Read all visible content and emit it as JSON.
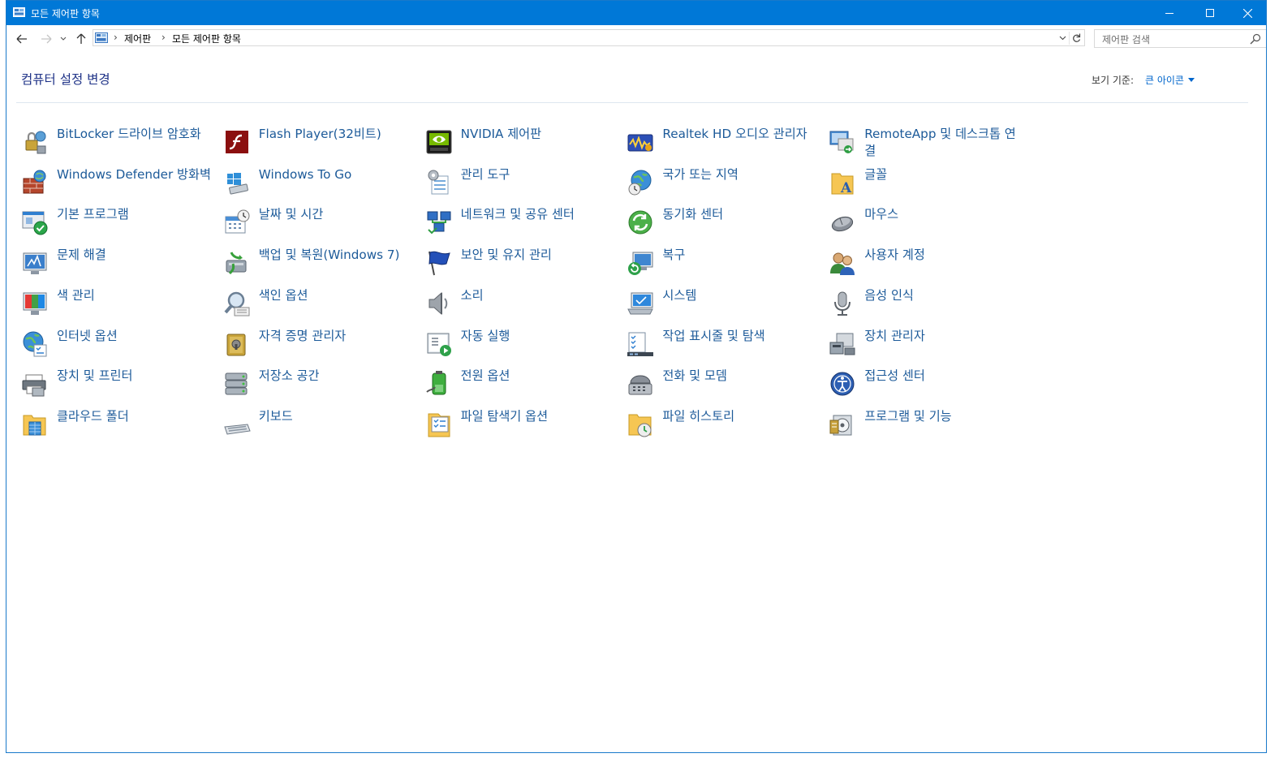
{
  "window": {
    "title": "모든 제어판 항목",
    "controls": {
      "minimize": "minimize-icon",
      "maximize": "maximize-icon",
      "close": "close-icon"
    }
  },
  "address": {
    "breadcrumb": [
      "제어판",
      "모든 제어판 항목"
    ],
    "search_placeholder": "제어판 검색"
  },
  "heading": "컴퓨터 설정 변경",
  "view_by": {
    "label": "보기 기준:",
    "value": "큰 아이콘"
  },
  "colors": {
    "titlebar": "#0078d7",
    "heading": "#1e3287",
    "link": "#1c5a99"
  },
  "items": [
    {
      "label": "BitLocker 드라이브 암호화",
      "icon": "bitlocker-icon"
    },
    {
      "label": "Flash Player(32비트)",
      "icon": "flash-player-icon"
    },
    {
      "label": "NVIDIA 제어판",
      "icon": "nvidia-icon"
    },
    {
      "label": "Realtek HD 오디오 관리자",
      "icon": "realtek-audio-icon"
    },
    {
      "label": "RemoteApp 및 데스크톱 연결",
      "icon": "remoteapp-icon"
    },
    {
      "label": "Windows Defender 방화벽",
      "icon": "firewall-icon"
    },
    {
      "label": "Windows To Go",
      "icon": "windows-to-go-icon"
    },
    {
      "label": "관리 도구",
      "icon": "admin-tools-icon"
    },
    {
      "label": "국가 또는 지역",
      "icon": "region-icon"
    },
    {
      "label": "글꼴",
      "icon": "fonts-icon"
    },
    {
      "label": "기본 프로그램",
      "icon": "default-programs-icon"
    },
    {
      "label": "날짜 및 시간",
      "icon": "date-time-icon"
    },
    {
      "label": "네트워크 및 공유 센터",
      "icon": "network-icon"
    },
    {
      "label": "동기화 센터",
      "icon": "sync-center-icon"
    },
    {
      "label": "마우스",
      "icon": "mouse-icon"
    },
    {
      "label": "문제 해결",
      "icon": "troubleshooting-icon"
    },
    {
      "label": "백업 및 복원(Windows 7)",
      "icon": "backup-restore-icon"
    },
    {
      "label": "보안 및 유지 관리",
      "icon": "security-flag-icon"
    },
    {
      "label": "복구",
      "icon": "recovery-icon"
    },
    {
      "label": "사용자 계정",
      "icon": "user-accounts-icon"
    },
    {
      "label": "색 관리",
      "icon": "color-management-icon"
    },
    {
      "label": "색인 옵션",
      "icon": "indexing-icon"
    },
    {
      "label": "소리",
      "icon": "sound-icon"
    },
    {
      "label": "시스템",
      "icon": "system-icon"
    },
    {
      "label": "음성 인식",
      "icon": "speech-recognition-icon"
    },
    {
      "label": "인터넷 옵션",
      "icon": "internet-options-icon"
    },
    {
      "label": "자격 증명 관리자",
      "icon": "credential-manager-icon"
    },
    {
      "label": "자동 실행",
      "icon": "autoplay-icon"
    },
    {
      "label": "작업 표시줄 및 탐색",
      "icon": "taskbar-icon"
    },
    {
      "label": "장치 관리자",
      "icon": "device-manager-icon"
    },
    {
      "label": "장치 및 프린터",
      "icon": "devices-printers-icon"
    },
    {
      "label": "저장소 공간",
      "icon": "storage-spaces-icon"
    },
    {
      "label": "전원 옵션",
      "icon": "power-options-icon"
    },
    {
      "label": "전화 및 모뎀",
      "icon": "phone-modem-icon"
    },
    {
      "label": "접근성 센터",
      "icon": "ease-of-access-icon"
    },
    {
      "label": "클라우드 폴더",
      "icon": "cloud-folder-icon"
    },
    {
      "label": "키보드",
      "icon": "keyboard-icon"
    },
    {
      "label": "파일 탐색기 옵션",
      "icon": "file-explorer-options-icon"
    },
    {
      "label": "파일 히스토리",
      "icon": "file-history-icon"
    },
    {
      "label": "프로그램 및 기능",
      "icon": "programs-features-icon"
    }
  ]
}
